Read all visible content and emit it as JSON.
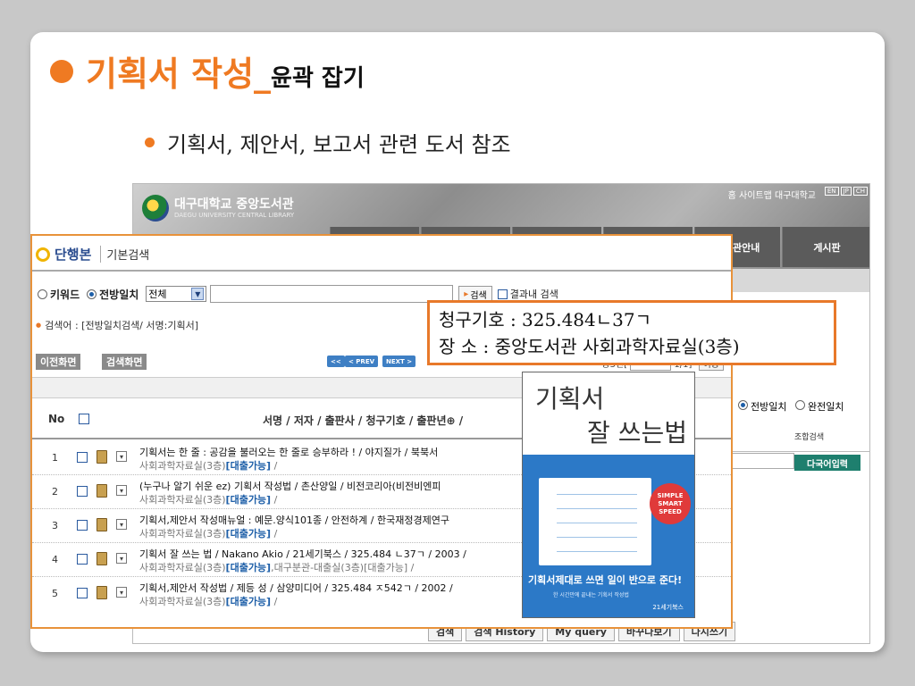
{
  "slide": {
    "title_main": "기획서 작성_",
    "title_sub": "윤곽 잡기",
    "bullet": "기획서, 제안서, 보고서 관련 도서 참조"
  },
  "library": {
    "logo_kr": "대구대학교 중앙도서관",
    "logo_en": "DAEGU UNIVERSITY CENTRAL LIBRARY",
    "top_links": "홈  사이트맵  대구대학교",
    "langs": [
      "EN",
      "JP",
      "CH"
    ],
    "tab_guide": "관안내",
    "tab_board": "게시판",
    "radio_prefix": "전방일치",
    "radio_exact": "완전일치",
    "combined_search": "조합검색",
    "multilang_btn": "다국어입력",
    "bottom_buttons": [
      "검색",
      "검색 History",
      "My query",
      "바꾸다보기",
      "다시쓰기"
    ]
  },
  "panel": {
    "title": "단행본",
    "subtitle": "기본검색",
    "radio_keyword": "키워드",
    "radio_prefix": "전방일치",
    "field_select": "전체",
    "search_btn": "검색",
    "in_result": "결과내 검색",
    "query_line": "검색어 : [전방일치검색/ 서명:기획서]",
    "prev_screen": "이전화면",
    "search_screen": "검색화면",
    "pg_first": "<<",
    "pg_prev": "< PREV",
    "pg_next": "NEXT >",
    "page_info": "총3건[",
    "page_info_end": "1/1]",
    "move_btn": "이동",
    "header_no": "No",
    "header_title": "서명 / 저자 / 출판사 / 청구기호 / 출판년⊕ /",
    "rows": [
      {
        "no": "1",
        "line1": "기획서는 한 줄 : 공감을 불러오는 한 줄로 승부하라 ! / 야지질가 / 북북서",
        "loc": "사회과학자료실(3층)",
        "status": "[대출가능]",
        "tail": " /"
      },
      {
        "no": "2",
        "line1": "(누구나 알기 쉬운 ez) 기획서 작성법 / 촌산양일 / 비전코리아(비전비엔피",
        "loc": "사회과학자료실(3층)",
        "status": "[대출가능]",
        "tail": " /"
      },
      {
        "no": "3",
        "line1": "기획서,제안서 작성매뉴얼 : 예문.양식101종 / 안전하계 / 한국재정경제연구",
        "loc": "사회과학자료실(3층)",
        "status": "[대출가능]",
        "tail": " /"
      },
      {
        "no": "4",
        "line1": "기획서 잘 쓰는 법 / Nakano Akio / 21세기북스 / 325.484 ㄴ37ㄱ / 2003 /",
        "loc": "사회과학자료실(3층)",
        "status": "[대출가능]",
        "tail": ",대구분관-대출실(3층)[대출가능] /"
      },
      {
        "no": "5",
        "line1": "기획서,제안서 작성법 / 제등 성 / 삼양미디어 / 325.484 ㅈ542ㄱ / 2002 /",
        "loc": "사회과학자료실(3층)",
        "status": "[대출가능]",
        "tail": " /"
      }
    ]
  },
  "callout": {
    "line1": "청구기호 : 325.484ㄴ37ㄱ",
    "line2": "장   소 : 중앙도서관 사회과학자료실(3층)"
  },
  "book": {
    "title1": "기획서",
    "title2": "잘 쓰는법",
    "badge": [
      "SIMPLE",
      "SMART",
      "SPEED"
    ],
    "slogan": "기획서제대로 쓰면 일이 반으로 준다!",
    "slogan2": "한 시간만에 끝내는 기획서 작성법",
    "publisher": "21세기북스"
  },
  "colors": {
    "accent": "#ef7a22",
    "link_blue": "#1e5fa8",
    "book_blue": "#2c79c7"
  }
}
